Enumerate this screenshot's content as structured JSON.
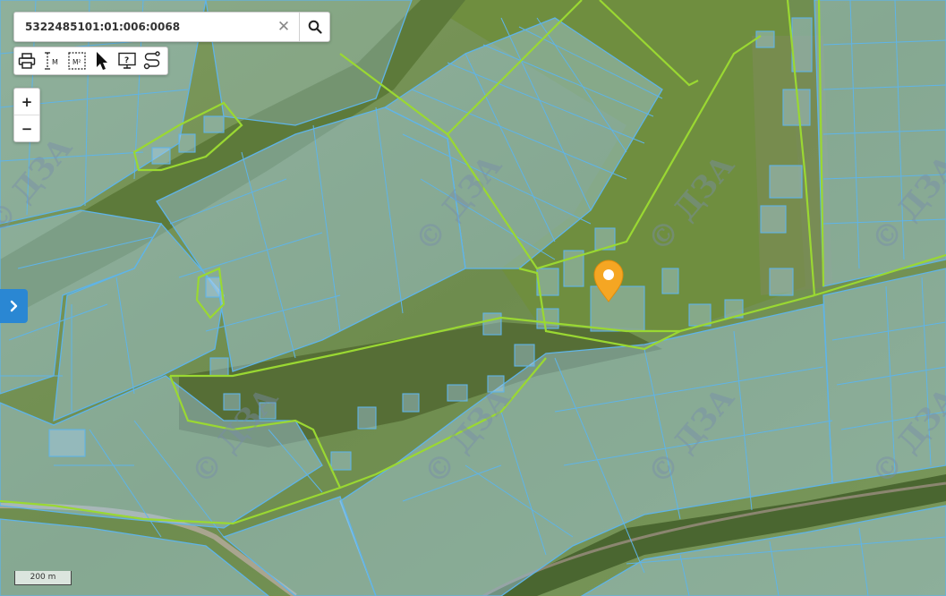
{
  "search": {
    "value": "5322485101:01:006:0068",
    "clear_glyph": "✕",
    "search_icon": "search-icon"
  },
  "toolbar": {
    "tools": [
      "print-icon",
      "measure-distance-icon",
      "measure-area-icon",
      "select-pointer-icon",
      "info-help-icon",
      "route-icon"
    ],
    "distance_label": "M",
    "area_label": "M²"
  },
  "zoom": {
    "in_label": "+",
    "out_label": "−"
  },
  "panel_toggle": {
    "icon": "chevron-right-icon"
  },
  "scale": {
    "label": "200 m"
  },
  "watermark": {
    "text": "© ДЗА"
  },
  "marker": {
    "icon": "map-pin-icon",
    "color": "#f5a623"
  },
  "colors": {
    "parcel_fill": "#a8d0f0",
    "parcel_stroke": "#5fb4e8",
    "boundary": "#9ad832",
    "panel_button": "#2a87d3"
  }
}
